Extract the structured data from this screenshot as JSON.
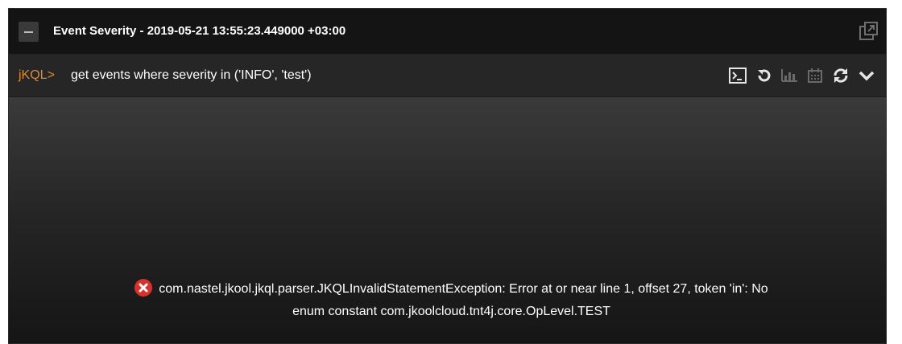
{
  "panel": {
    "title": "Event Severity - 2019-05-21 13:55:23.449000 +03:00",
    "icons": {
      "collapse": "minus-icon",
      "popout": "external-window-icon"
    }
  },
  "query_bar": {
    "prompt": "jKQL>",
    "query": "get events where severity in ('INFO', 'test')",
    "tools": [
      {
        "name": "terminal-icon"
      },
      {
        "name": "undo-icon"
      },
      {
        "name": "bar-chart-icon"
      },
      {
        "name": "calendar-icon"
      },
      {
        "name": "refresh-icon"
      },
      {
        "name": "chevron-down-icon"
      }
    ]
  },
  "error": {
    "line1": "com.nastel.jkool.jkql.parser.JKQLInvalidStatementException: Error at or near line 1, offset 27, token 'in': No",
    "line2": "enum constant com.jkoolcloud.tnt4j.core.OpLevel.TEST"
  },
  "colors": {
    "prompt": "#e08a2e",
    "error_icon": "#d8322d",
    "background": "#1a1a1a"
  }
}
